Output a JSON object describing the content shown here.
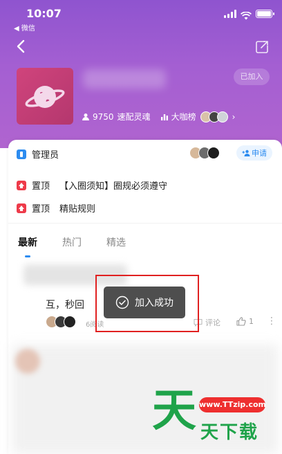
{
  "status_bar": {
    "time": "10:07",
    "back_app": "◀ 微信"
  },
  "header": {
    "joined_label": "已加入",
    "member_count": "9750",
    "member_label": "速配灵魂",
    "leaderboard_label": "大咖榜",
    "gradient_colors": [
      "#8f54cf",
      "#b064cf"
    ]
  },
  "info_rows": {
    "admin_label": "管理员",
    "apply_label": "申请",
    "pinned": [
      {
        "tag": "置顶",
        "title": "【入圈须知】圈规必须遵守"
      },
      {
        "tag": "置顶",
        "title": "精贴规则"
      }
    ]
  },
  "tabs": [
    {
      "label": "最新",
      "active": true
    },
    {
      "label": "热门",
      "active": false
    },
    {
      "label": "精选",
      "active": false
    }
  ],
  "post": {
    "text": "互，秒回",
    "views": "6阅读",
    "comment_label": "评论",
    "like_count": "1"
  },
  "toast": {
    "message": "加入成功"
  },
  "watermark": {
    "big": "天",
    "url": "www.TTzip.com",
    "small": "天下载"
  },
  "colors": {
    "accent": "#2d8cf0",
    "pin_red": "#ee3b4a",
    "toast_bg": "#444444",
    "highlight": "#e02020"
  }
}
